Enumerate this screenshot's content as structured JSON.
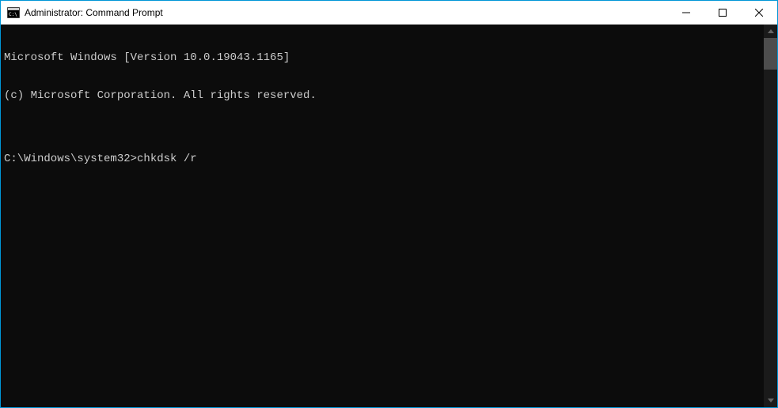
{
  "window": {
    "title": "Administrator: Command Prompt"
  },
  "terminal": {
    "line1": "Microsoft Windows [Version 10.0.19043.1165]",
    "line2": "(c) Microsoft Corporation. All rights reserved.",
    "blank": "",
    "prompt": "C:\\Windows\\system32>",
    "command": "chkdsk /r"
  }
}
